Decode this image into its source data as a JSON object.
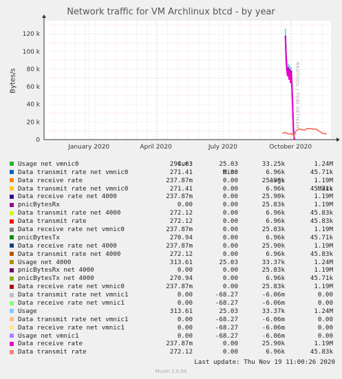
{
  "title": "Network traffic for VM Archlinux btcd - by year",
  "side_label": "RRDTOOL / TOBI OETIKER",
  "footer": "Munin 2.0.64",
  "last_update": "Last update: Thu Nov 19 11:00:26 2020",
  "legend_headers": {
    "cur": "Cur:",
    "min": "Min:",
    "avg": "Avg:",
    "max": "Max:"
  },
  "colors": {
    "background": "#f0f0f0",
    "plot_bg": "#ffffff",
    "grid_minor": "#e9b6b6",
    "grid_major": "#c9c9c9"
  },
  "chart_data": {
    "type": "line",
    "title": "Network traffic for VM Archlinux btcd - by year",
    "ylabel": "Bytes/s",
    "ylim": [
      0,
      135000
    ],
    "yticks": [
      0,
      20000,
      40000,
      60000,
      80000,
      100000,
      120000
    ],
    "ytick_labels": [
      "0",
      "20 k",
      "40 k",
      "60 k",
      "80 k",
      "100 k",
      "120 k"
    ],
    "xticks": [
      {
        "date": "2020-01-01",
        "label": "January 2020"
      },
      {
        "date": "2020-04-01",
        "label": "April 2020"
      },
      {
        "date": "2020-07-01",
        "label": "July 2020"
      },
      {
        "date": "2020-10-01",
        "label": "October 2020"
      }
    ],
    "xlim": [
      "2019-11-01",
      "2020-11-25"
    ],
    "grid": true,
    "series": [
      {
        "name": "Usage",
        "color": "#8ecbe8",
        "x": [
          "2020-09-24",
          "2020-09-25",
          "2020-09-26",
          "2020-09-27",
          "2020-09-28",
          "2020-09-29",
          "2020-09-30",
          "2020-10-01",
          "2020-10-02",
          "2020-10-03",
          "2020-10-04",
          "2020-10-05",
          "2020-10-06",
          "2020-10-07"
        ],
        "y": [
          126000,
          94000,
          84000,
          80000,
          86000,
          76000,
          84000,
          70000,
          82000,
          64000,
          40000,
          14000,
          2000,
          0
        ]
      },
      {
        "name": "pnicBytesRx",
        "color": "#9400a8",
        "x": [
          "2020-09-24",
          "2020-09-25",
          "2020-09-26",
          "2020-09-27",
          "2020-09-28",
          "2020-09-29",
          "2020-09-30",
          "2020-10-01",
          "2020-10-02",
          "2020-10-03",
          "2020-10-04",
          "2020-10-05",
          "2020-10-06",
          "2020-10-07"
        ],
        "y": [
          118000,
          96000,
          80000,
          74000,
          82000,
          70000,
          80000,
          66000,
          78000,
          60000,
          36000,
          10000,
          1500,
          0
        ]
      },
      {
        "name": "Data receive rate",
        "color": "#ee00cc",
        "x": [
          "2020-09-24",
          "2020-09-25",
          "2020-09-26",
          "2020-09-27",
          "2020-09-28",
          "2020-09-29",
          "2020-09-30",
          "2020-10-01",
          "2020-10-02",
          "2020-10-03",
          "2020-10-04",
          "2020-10-05",
          "2020-10-06",
          "2020-10-07"
        ],
        "y": [
          116000,
          90000,
          78000,
          72000,
          80000,
          68000,
          78000,
          64000,
          76000,
          58000,
          34000,
          9000,
          1000,
          0
        ]
      },
      {
        "name": "Data transmit rate",
        "color": "#f08070",
        "x": [
          "2020-09-20",
          "2020-09-24",
          "2020-09-28",
          "2020-10-02",
          "2020-10-06",
          "2020-10-08",
          "2020-10-12",
          "2020-10-16",
          "2020-10-20",
          "2020-10-24",
          "2020-10-28",
          "2020-11-01",
          "2020-11-05",
          "2020-11-09",
          "2020-11-13",
          "2020-11-17",
          "2020-11-19"
        ],
        "y": [
          7500,
          8000,
          6500,
          6800,
          4000,
          9500,
          12000,
          11500,
          11000,
          12500,
          12500,
          12000,
          11800,
          9500,
          7500,
          6500,
          7000
        ]
      }
    ]
  },
  "legend": [
    {
      "name": "Usage net vmnic0",
      "color": "#22bb22",
      "cur": "294.63",
      "min": "25.03",
      "avg": "33.25k",
      "max": "1.24M"
    },
    {
      "name": "Data transmit rate net vmnic0",
      "color": "#0066bb",
      "cur": "271.41",
      "min": "0.00",
      "avg": "6.96k",
      "max": "45.71k"
    },
    {
      "name": "Data receive rate",
      "color": "#ff8800",
      "cur": "237.87m",
      "min": "0.00",
      "avg": "25.90k",
      "max": "1.19M"
    },
    {
      "name": "Data transmit rate net vmnic0",
      "color": "#ffcc00",
      "cur": "271.41",
      "min": "0.00",
      "avg": "6.96k",
      "max": "45.71k"
    },
    {
      "name": "Data receive rate net 4000",
      "color": "#330099",
      "cur": "237.87m",
      "min": "0.00",
      "avg": "25.90k",
      "max": "1.19M"
    },
    {
      "name": "pnicBytesRx",
      "color": "#990099",
      "cur": "0.00",
      "min": "0.00",
      "avg": "25.83k",
      "max": "1.19M"
    },
    {
      "name": "Data transmit rate net 4000",
      "color": "#ccff00",
      "cur": "272.12",
      "min": "0.00",
      "avg": "6.96k",
      "max": "45.83k"
    },
    {
      "name": "Data transmit rate",
      "color": "#ff0000",
      "cur": "272.12",
      "min": "0.00",
      "avg": "6.96k",
      "max": "45.83k"
    },
    {
      "name": "Data receive rate net vmnic0",
      "color": "#808080",
      "cur": "237.87m",
      "min": "0.00",
      "avg": "25.83k",
      "max": "1.19M"
    },
    {
      "name": "pnicBytesTx",
      "color": "#008f00",
      "cur": "270.94",
      "min": "0.00",
      "avg": "6.96k",
      "max": "45.71k"
    },
    {
      "name": "Data receive rate net 4000",
      "color": "#00487d",
      "cur": "237.87m",
      "min": "0.00",
      "avg": "25.90k",
      "max": "1.19M"
    },
    {
      "name": "Data transmit rate net 4000",
      "color": "#b35a00",
      "cur": "272.12",
      "min": "0.00",
      "avg": "6.96k",
      "max": "45.83k"
    },
    {
      "name": "Usage net 4000",
      "color": "#b38f00",
      "cur": "313.61",
      "min": "25.03",
      "avg": "33.37k",
      "max": "1.24M"
    },
    {
      "name": "pnicBytesRx net 4000",
      "color": "#6b006b",
      "cur": "0.00",
      "min": "0.00",
      "avg": "25.83k",
      "max": "1.19M"
    },
    {
      "name": "pnicBytesTx net 4000",
      "color": "#8fb300",
      "cur": "270.94",
      "min": "0.00",
      "avg": "6.96k",
      "max": "45.71k"
    },
    {
      "name": "Data receive rate net vmnic0",
      "color": "#b30000",
      "cur": "237.87m",
      "min": "0.00",
      "avg": "25.83k",
      "max": "1.19M"
    },
    {
      "name": "Data transmit rate net vmnic1",
      "color": "#bebebe",
      "cur": "0.00",
      "min": "-68.27",
      "avg": "-6.06m",
      "max": "0.00"
    },
    {
      "name": "Data receive rate net vmnic1",
      "color": "#80ff80",
      "cur": "0.00",
      "min": "-68.27",
      "avg": "-6.06m",
      "max": "0.00"
    },
    {
      "name": "Usage",
      "color": "#80c9ff",
      "cur": "313.61",
      "min": "25.03",
      "avg": "33.37k",
      "max": "1.24M"
    },
    {
      "name": "Data transmit rate net vmnic1",
      "color": "#ffc080",
      "cur": "0.00",
      "min": "-68.27",
      "avg": "-6.06m",
      "max": "0.00"
    },
    {
      "name": "Data receive rate net vmnic1",
      "color": "#ffe680",
      "cur": "0.00",
      "min": "-68.27",
      "avg": "-6.06m",
      "max": "0.00"
    },
    {
      "name": "Usage net vmnic1",
      "color": "#aa80ff",
      "cur": "0.00",
      "min": "-68.27",
      "avg": "-6.06m",
      "max": "0.00"
    },
    {
      "name": "Data receive rate",
      "color": "#ee00cc",
      "cur": "237.87m",
      "min": "0.00",
      "avg": "25.90k",
      "max": "1.19M"
    },
    {
      "name": "Data transmit rate",
      "color": "#ff8080",
      "cur": "272.12",
      "min": "0.00",
      "avg": "6.96k",
      "max": "45.83k"
    }
  ]
}
